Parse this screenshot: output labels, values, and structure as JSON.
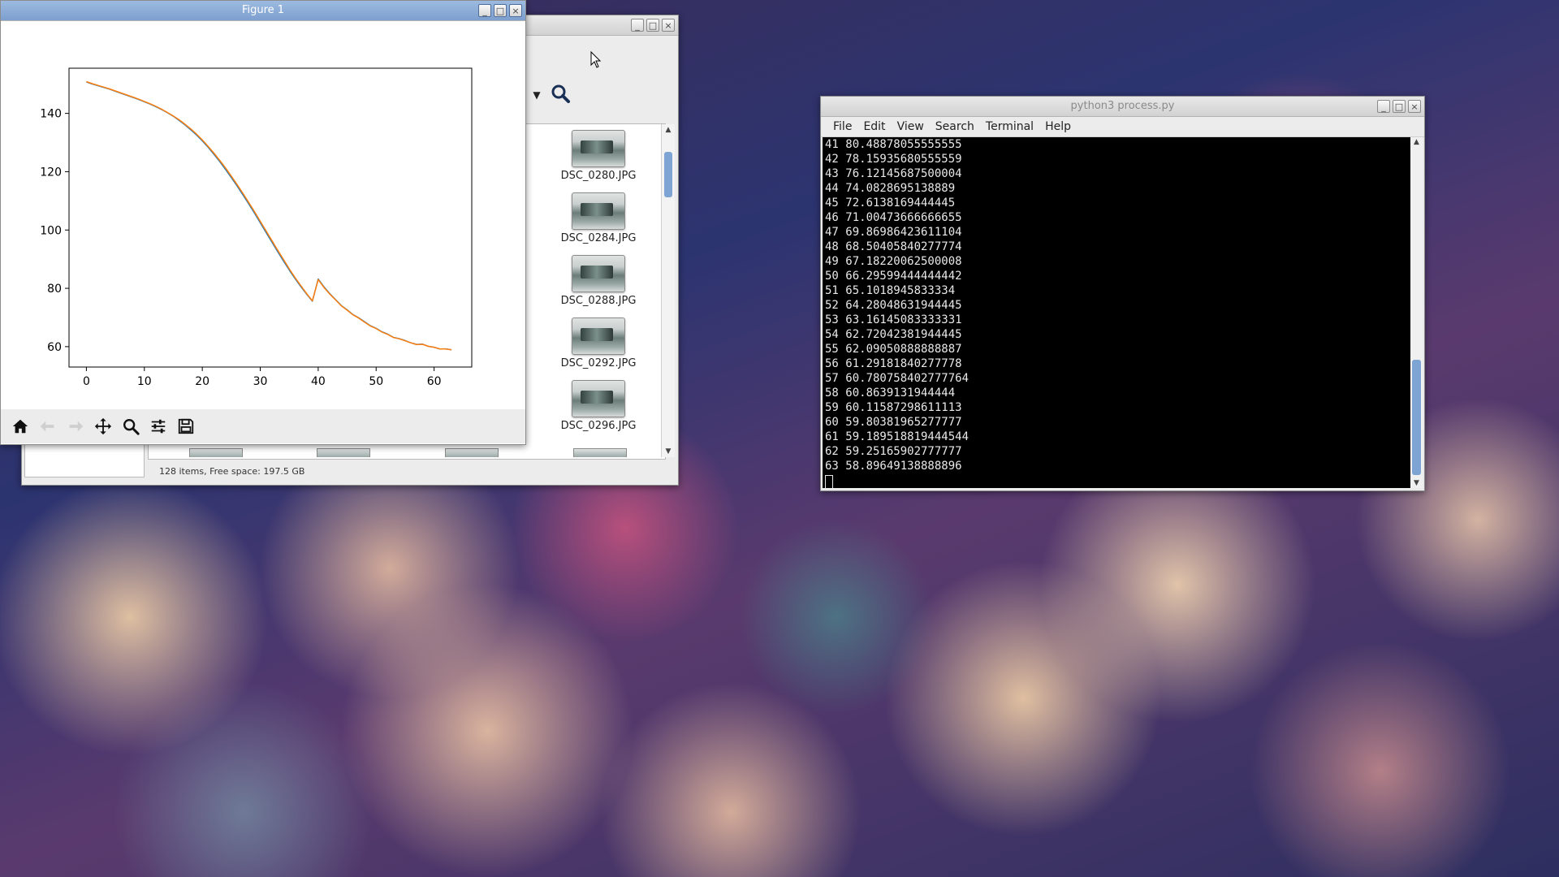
{
  "figure_window": {
    "title": "Figure 1",
    "buttons": {
      "minimize": "_",
      "maximize": "□",
      "close": "×"
    },
    "toolbar_icons": [
      "home-icon",
      "back-arrow-icon",
      "forward-arrow-icon",
      "pan-icon",
      "zoom-icon",
      "configure-subplots-icon",
      "save-icon"
    ]
  },
  "chart_data": {
    "type": "line",
    "title": "",
    "xlabel": "",
    "ylabel": "",
    "xlim": [
      -3,
      66.5
    ],
    "ylim": [
      53,
      155.5
    ],
    "xticks": [
      0,
      10,
      20,
      30,
      40,
      50,
      60
    ],
    "yticks": [
      60,
      80,
      100,
      120,
      140
    ],
    "grid": false,
    "colors": [
      "#1f77b4",
      "#ff7f0e"
    ],
    "series": [
      {
        "values": [
          150.8,
          150.1,
          149.5,
          148.9,
          148.3,
          147.6,
          146.9,
          146.2,
          145.5,
          144.8,
          144.0,
          143.2,
          142.3,
          141.3,
          140.2,
          139.0,
          137.6,
          136.1,
          134.4,
          132.6,
          130.6,
          128.4,
          126.0,
          123.5,
          120.8,
          118.0,
          115.1,
          112.1,
          109.0,
          105.8,
          102.5,
          99.2,
          95.9,
          92.6,
          89.4,
          86.3,
          83.4,
          80.6,
          78.0,
          75.6,
          83.2,
          80.48878055555555,
          78.15935680555559,
          76.12145687500004,
          74.0828695138889,
          72.6138169444445,
          71.00473666666655,
          69.86986423611104,
          68.50405840277774,
          67.18220062500008,
          66.29599444444442,
          65.1018945833334,
          64.28048631944445,
          63.16145083333331,
          62.72042381944445,
          62.09050888888887,
          61.29181840277778,
          60.780758402777764,
          60.8639131944444,
          60.11587298611113,
          59.80381965277777,
          59.189518819444544,
          59.25165902777777,
          58.89649138888896
        ]
      },
      {
        "values": [
          150.9,
          150.2,
          149.6,
          149.0,
          148.4,
          147.7,
          147.0,
          146.3,
          145.6,
          144.9,
          144.1,
          143.3,
          142.4,
          141.4,
          140.3,
          139.1,
          137.8,
          136.3,
          134.7,
          132.9,
          130.9,
          128.7,
          126.4,
          123.9,
          121.3,
          118.5,
          115.6,
          112.6,
          109.5,
          106.3,
          103.0,
          99.7,
          96.4,
          93.1,
          89.9,
          86.7,
          83.7,
          80.9,
          78.2,
          75.7,
          83.0,
          80.3,
          78.0,
          76.0,
          74.0,
          72.5,
          70.9,
          69.8,
          68.4,
          67.1,
          66.2,
          65.0,
          64.2,
          63.1,
          62.7,
          62.0,
          61.3,
          60.7,
          60.8,
          60.1,
          59.8,
          59.2,
          59.2,
          58.9
        ]
      }
    ]
  },
  "file_manager": {
    "buttons": {
      "minimize": "_",
      "maximize": "□",
      "close": "×"
    },
    "dropdown_arrow": "▼",
    "items": [
      {
        "name": "DSC_0280.JPG"
      },
      {
        "name": "DSC_0284.JPG"
      },
      {
        "name": "DSC_0288.JPG"
      },
      {
        "name": "DSC_0292.JPG"
      },
      {
        "name": "DSC_0296.JPG"
      }
    ],
    "status": "128 items, Free space: 197.5 GB"
  },
  "terminal": {
    "title": "python3 process.py",
    "buttons": {
      "minimize": "_",
      "maximize": "□",
      "close": "×"
    },
    "menu": [
      "File",
      "Edit",
      "View",
      "Search",
      "Terminal",
      "Help"
    ],
    "lines": [
      "41 80.48878055555555",
      "42 78.15935680555559",
      "43 76.12145687500004",
      "44 74.0828695138889",
      "45 72.6138169444445",
      "46 71.00473666666655",
      "47 69.86986423611104",
      "48 68.50405840277774",
      "49 67.18220062500008",
      "50 66.29599444444442",
      "51 65.1018945833334",
      "52 64.28048631944445",
      "53 63.16145083333331",
      "54 62.72042381944445",
      "55 62.09050888888887",
      "56 61.29181840277778",
      "57 60.780758402777764",
      "58 60.8639131944444",
      "59 60.11587298611113",
      "60 59.80381965277777",
      "61 59.189518819444544",
      "62 59.25165902777777",
      "63 58.89649138888896"
    ]
  }
}
